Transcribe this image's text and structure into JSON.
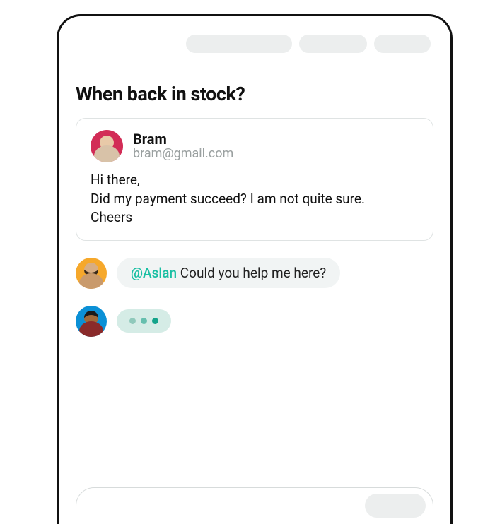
{
  "conversation": {
    "title": "When back in stock?",
    "email": {
      "sender_name": "Bram",
      "sender_email": "bram@gmail.com",
      "body_line1": "Hi there,",
      "body_line2": "Did my payment succeed? I am not quite sure.",
      "body_line3": "Cheers"
    },
    "notes": [
      {
        "mention": "@Aslan",
        "text": " Could you help me here?"
      }
    ]
  }
}
